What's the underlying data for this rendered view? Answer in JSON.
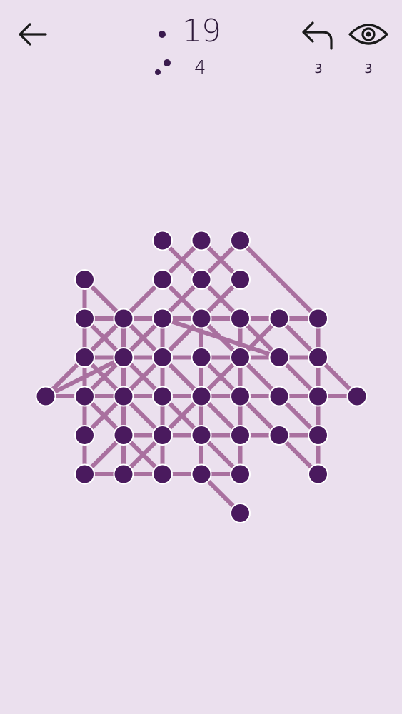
{
  "header": {
    "moves_count": "19",
    "pairs_count": "4",
    "undo_count": "3",
    "hint_count": "3",
    "back_icon": "arrow-left-icon",
    "undo_icon": "undo-arrow-icon",
    "hint_icon": "eye-icon",
    "moves_icon": "single-dot-icon",
    "pairs_icon": "double-dot-icon"
  },
  "colors": {
    "background": "#ebe0ee",
    "node": "#4a1a5e",
    "node_outline": "#ffffff",
    "edge": "#a9709f",
    "text": "#2e1a3a"
  },
  "puzzle": {
    "grid_columns": 9,
    "grid_rows": 8,
    "nodes": [
      [
        3,
        0
      ],
      [
        4,
        0
      ],
      [
        5,
        0
      ],
      [
        1,
        1
      ],
      [
        3,
        1
      ],
      [
        4,
        1
      ],
      [
        5,
        1
      ],
      [
        1,
        2
      ],
      [
        2,
        2
      ],
      [
        3,
        2
      ],
      [
        4,
        2
      ],
      [
        5,
        2
      ],
      [
        6,
        2
      ],
      [
        7,
        2
      ],
      [
        1,
        3
      ],
      [
        2,
        3
      ],
      [
        3,
        3
      ],
      [
        4,
        3
      ],
      [
        5,
        3
      ],
      [
        6,
        3
      ],
      [
        7,
        3
      ],
      [
        0,
        4
      ],
      [
        1,
        4
      ],
      [
        2,
        4
      ],
      [
        3,
        4
      ],
      [
        4,
        4
      ],
      [
        5,
        4
      ],
      [
        6,
        4
      ],
      [
        7,
        4
      ],
      [
        8,
        4
      ],
      [
        1,
        5
      ],
      [
        2,
        5
      ],
      [
        3,
        5
      ],
      [
        4,
        5
      ],
      [
        5,
        5
      ],
      [
        6,
        5
      ],
      [
        7,
        5
      ],
      [
        1,
        6
      ],
      [
        2,
        6
      ],
      [
        3,
        6
      ],
      [
        4,
        6
      ],
      [
        5,
        6
      ],
      [
        7,
        6
      ],
      [
        5,
        7
      ]
    ],
    "edges": [
      [
        [
          3,
          0
        ],
        [
          5,
          2
        ]
      ],
      [
        [
          4,
          0
        ],
        [
          3,
          1
        ]
      ],
      [
        [
          5,
          0
        ],
        [
          4,
          1
        ]
      ],
      [
        [
          5,
          0
        ],
        [
          7,
          2
        ]
      ],
      [
        [
          4,
          0
        ],
        [
          5,
          1
        ]
      ],
      [
        [
          3,
          1
        ],
        [
          1,
          3
        ]
      ],
      [
        [
          4,
          1
        ],
        [
          2,
          3
        ]
      ],
      [
        [
          5,
          1
        ],
        [
          3,
          3
        ]
      ],
      [
        [
          3,
          1
        ],
        [
          5,
          3
        ]
      ],
      [
        [
          4,
          1
        ],
        [
          7,
          4
        ]
      ],
      [
        [
          1,
          1
        ],
        [
          1,
          2
        ]
      ],
      [
        [
          1,
          1
        ],
        [
          2,
          2
        ]
      ],
      [
        [
          1,
          2
        ],
        [
          7,
          2
        ]
      ],
      [
        [
          1,
          2
        ],
        [
          1,
          6
        ]
      ],
      [
        [
          2,
          2
        ],
        [
          2,
          6
        ]
      ],
      [
        [
          3,
          2
        ],
        [
          3,
          6
        ]
      ],
      [
        [
          4,
          2
        ],
        [
          4,
          6
        ]
      ],
      [
        [
          5,
          2
        ],
        [
          5,
          6
        ]
      ],
      [
        [
          1,
          2
        ],
        [
          4,
          5
        ]
      ],
      [
        [
          2,
          2
        ],
        [
          5,
          5
        ]
      ],
      [
        [
          3,
          2
        ],
        [
          6,
          3
        ]
      ],
      [
        [
          5,
          2
        ],
        [
          6,
          3
        ]
      ],
      [
        [
          6,
          2
        ],
        [
          3,
          5
        ]
      ],
      [
        [
          6,
          2
        ],
        [
          7,
          3
        ]
      ],
      [
        [
          1,
          3
        ],
        [
          7,
          3
        ]
      ],
      [
        [
          7,
          2
        ],
        [
          7,
          6
        ]
      ],
      [
        [
          7,
          3
        ],
        [
          8,
          4
        ]
      ],
      [
        [
          1,
          3
        ],
        [
          2,
          2
        ]
      ],
      [
        [
          2,
          3
        ],
        [
          4,
          1
        ]
      ],
      [
        [
          1,
          4
        ],
        [
          3,
          2
        ]
      ],
      [
        [
          1,
          5
        ],
        [
          5,
          1
        ]
      ],
      [
        [
          1,
          6
        ],
        [
          2,
          5
        ]
      ],
      [
        [
          2,
          6
        ],
        [
          6,
          2
        ]
      ],
      [
        [
          1,
          3
        ],
        [
          3,
          5
        ]
      ],
      [
        [
          1,
          4
        ],
        [
          3,
          6
        ]
      ],
      [
        [
          2,
          3
        ],
        [
          4,
          5
        ]
      ],
      [
        [
          3,
          3
        ],
        [
          4,
          4
        ]
      ],
      [
        [
          4,
          3
        ],
        [
          6,
          5
        ]
      ],
      [
        [
          5,
          3
        ],
        [
          7,
          5
        ]
      ],
      [
        [
          5,
          4
        ],
        [
          7,
          6
        ]
      ],
      [
        [
          3,
          4
        ],
        [
          5,
          6
        ]
      ],
      [
        [
          0,
          4
        ],
        [
          8,
          4
        ]
      ],
      [
        [
          0,
          4
        ],
        [
          1,
          3
        ]
      ],
      [
        [
          0,
          4
        ],
        [
          2,
          3
        ]
      ],
      [
        [
          2,
          5
        ],
        [
          7,
          5
        ]
      ],
      [
        [
          1,
          6
        ],
        [
          5,
          6
        ]
      ],
      [
        [
          4,
          6
        ],
        [
          5,
          7
        ]
      ]
    ]
  }
}
